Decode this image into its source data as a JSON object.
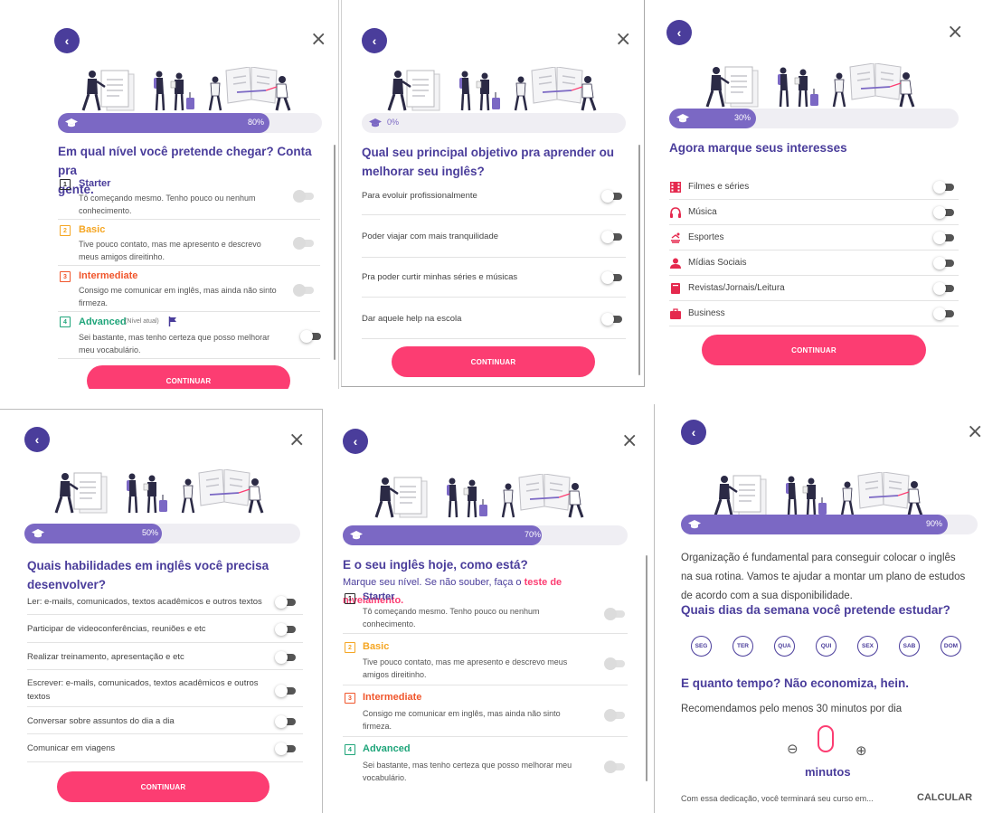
{
  "common": {
    "back_glyph": "‹",
    "close_glyph": "×",
    "continue_label": "CONTINUAR",
    "colors": {
      "brand_purple": "#4a3d9b",
      "progress_fill": "#7b68c4",
      "cta_pink": "#fc3d72"
    }
  },
  "levels": [
    {
      "num": "1",
      "name": "Starter",
      "desc": "Tô começando mesmo. Tenho pouco ou nenhum conhecimento.",
      "color": "#2b2b2b"
    },
    {
      "num": "2",
      "name": "Basic",
      "desc": "Tive pouco contato, mas me apresento e descrevo meus amigos direitinho.",
      "color": "#f5a623"
    },
    {
      "num": "3",
      "name": "Intermediate",
      "desc": "Consigo me comunicar em inglês, mas ainda não sinto firmeza.",
      "color": "#f0562c"
    },
    {
      "num": "4",
      "name": "Advanced",
      "desc": "Sei bastante, mas tenho certeza que posso melhorar meu vocabulário.",
      "color": "#1fa57a"
    }
  ],
  "screen1": {
    "progress": 80,
    "progress_label": "80%",
    "title_line1": "Em qual nível você pretende chegar? Conta pra",
    "title_line2": "gente.",
    "current_level_note": "(Nível atual)"
  },
  "screen2": {
    "progress": 0,
    "progress_label": "0%",
    "title_line1": "Qual seu principal objetivo pra aprender ou",
    "title_line2": "melhorar seu inglês?",
    "options": [
      "Para evoluir profissionalmente",
      "Poder viajar com mais tranquilidade",
      "Pra poder curtir minhas séries e músicas",
      "Dar aquele help na escola"
    ]
  },
  "screen3": {
    "progress": 30,
    "progress_label": "30%",
    "title": "Agora marque seus interesses",
    "interests": [
      {
        "label": "Filmes e séries",
        "icon": "film-icon"
      },
      {
        "label": "Música",
        "icon": "headphones-icon"
      },
      {
        "label": "Esportes",
        "icon": "sports-icon"
      },
      {
        "label": "Mídias Sociais",
        "icon": "person-icon"
      },
      {
        "label": "Revistas/Jornais/Leitura",
        "icon": "book-icon"
      },
      {
        "label": "Business",
        "icon": "briefcase-icon"
      }
    ]
  },
  "screen4": {
    "progress": 50,
    "progress_label": "50%",
    "title_line1": "Quais habilidades em inglês você precisa",
    "title_line2": "desenvolver?",
    "options": [
      "Ler: e-mails, comunicados, textos acadêmicos e outros textos",
      "Participar de videoconferências, reuniões e etc",
      "Realizar treinamento, apresentação e etc",
      "Escrever: e-mails, comunicados, textos acadêmicos e outros textos",
      "Conversar sobre assuntos do dia a dia",
      "Comunicar em viagens"
    ]
  },
  "screen5": {
    "progress": 70,
    "progress_label": "70%",
    "title": "E o seu inglês hoje, como está?",
    "subtitle_line1": "Marque seu nível. Se não souber, faça o",
    "subtitle_link_a": "teste de",
    "subtitle_link_b": "nivelamento."
  },
  "screen6": {
    "progress": 90,
    "progress_label": "90%",
    "intro_line1": "Organização é fundamental para conseguir colocar o inglês",
    "intro_line2": "na sua rotina. Vamos te ajudar a montar um plano de estudos",
    "intro_line3": "de acordo com a sua disponibilidade.",
    "days_title": "Quais dias da semana você pretende estudar?",
    "days": [
      "SEG",
      "TER",
      "QUA",
      "QUI",
      "SEX",
      "SAB",
      "DOM"
    ],
    "time_title": "E quanto tempo? Não economiza, hein.",
    "recommendation": "Recomendamos pelo menos 30 minutos por dia",
    "minutes_value": "0",
    "minus_glyph": "⊖",
    "plus_glyph": "⊕",
    "minutes_label": "minutos",
    "finish_text": "Com essa dedicação, você terminará seu curso em...",
    "calc_label": "CALCULAR"
  }
}
